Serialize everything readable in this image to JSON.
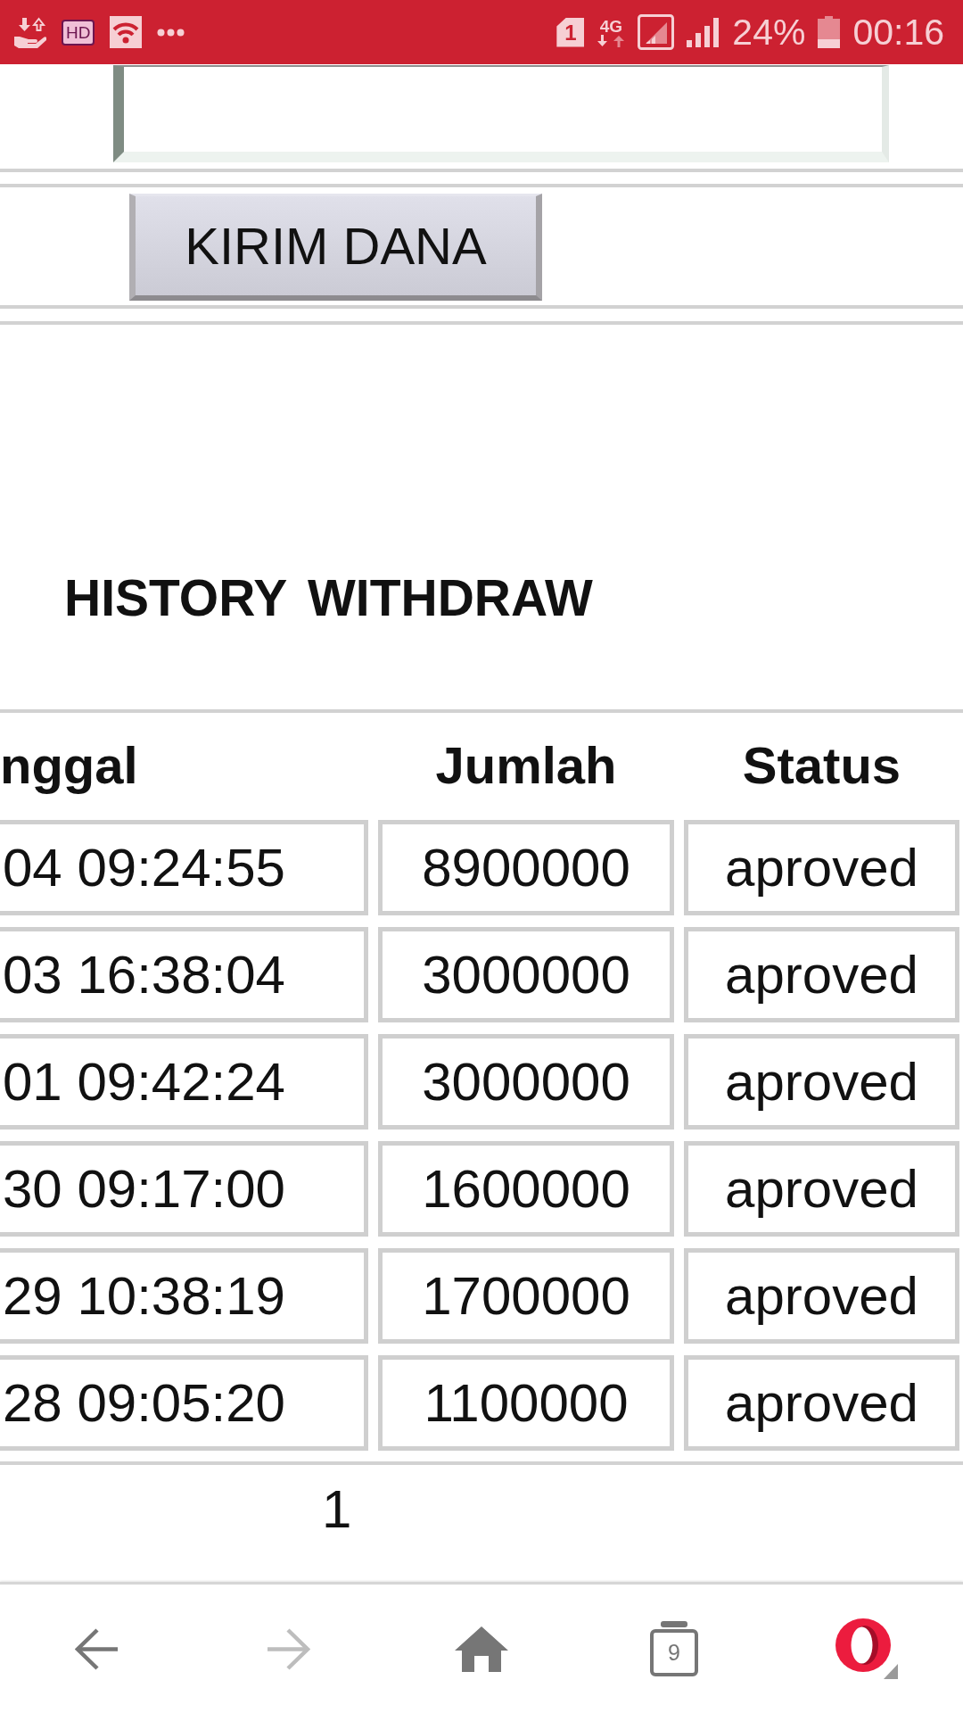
{
  "status_bar": {
    "hd_label": "HD",
    "sim_slot": "1",
    "network_type": "4G",
    "battery_percent": "24%",
    "time": "00:16"
  },
  "transfer_form": {
    "submit_button": "KIRIM DANA"
  },
  "history": {
    "title": "HISTORY WITHDRAW",
    "columns": [
      "nggal",
      "Jumlah",
      "Status"
    ],
    "rows": [
      [
        "04 09:24:55",
        "8900000",
        "aproved"
      ],
      [
        "03 16:38:04",
        "3000000",
        "aproved"
      ],
      [
        "01 09:42:24",
        "3000000",
        "aproved"
      ],
      [
        "30 09:17:00",
        "1600000",
        "aproved"
      ],
      [
        "29 10:38:19",
        "1700000",
        "aproved"
      ],
      [
        "28 09:05:20",
        "1100000",
        "aproved"
      ]
    ],
    "pagination": {
      "pages": [
        "1"
      ]
    }
  },
  "browser_bar": {
    "buttons": [
      {
        "kind": "back",
        "disabled": false
      },
      {
        "kind": "forward",
        "disabled": true
      },
      {
        "kind": "home",
        "disabled": false
      },
      {
        "kind": "tabs",
        "disabled": false,
        "count": "9"
      },
      {
        "kind": "menu",
        "disabled": false
      }
    ]
  }
}
